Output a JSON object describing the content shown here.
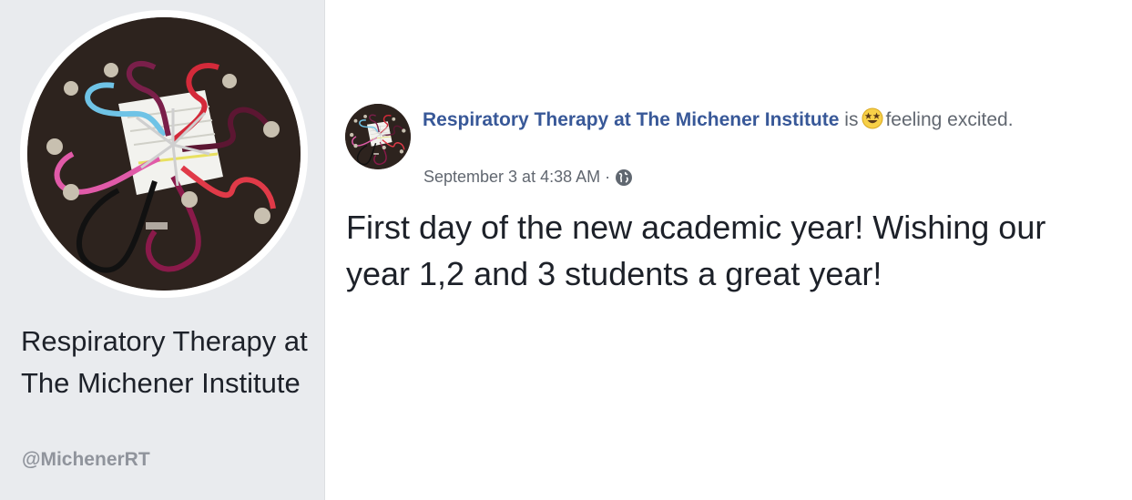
{
  "page": {
    "name": "Respiratory Therapy at The Michener Institute",
    "handle": "@MichenerRT"
  },
  "post": {
    "author": "Respiratory Therapy at The Michener Institute",
    "is_word": "is",
    "feeling_emoji": "star-struck-emoji-icon",
    "feeling_text": "feeling excited.",
    "timestamp": "September 3 at 4:38 AM",
    "separator": "·",
    "privacy_icon": "globe-icon",
    "text": "First day of the new academic year! Wishing our year 1,2 and 3 students a great year!"
  },
  "colors": {
    "author_link": "#385898",
    "meta_text": "#616770",
    "sidebar_bg": "#e9ebee",
    "body_text": "#1d2129"
  }
}
